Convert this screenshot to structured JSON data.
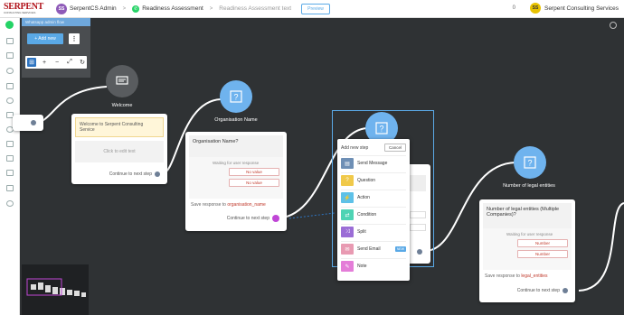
{
  "header": {
    "logo_text": "SERPENT",
    "logo_subtext": "CONSULTING SERVICES",
    "org_avatar": "SS",
    "org_name": "SerpentCS Admin",
    "flow_name": "Readiness Assessment",
    "flow_subtitle": "Readiness Assessment text",
    "preview_label": "Preview",
    "notifications": "0",
    "user_avatar": "SS",
    "user_name": "Serpent Consulting Services"
  },
  "toolbar": {
    "title": "Whatsapp admin flow",
    "add_label": "+ Add new",
    "kebab": "⋮"
  },
  "nodes": {
    "welcome": {
      "title": "Welcome",
      "message": "Welcome to Serpent Consulting Service",
      "edit_hint": "Click to edit text",
      "continue": "Continue to next step"
    },
    "org_name": {
      "title": "Organisation Name",
      "question": "Organisation Name?",
      "hint": "Waiting for user response",
      "options": [
        "No value",
        "No value"
      ],
      "save_prefix": "Save response to ",
      "save_var": "organisation_name",
      "continue": "Continue to next step"
    },
    "legal": {
      "title": "Number of legal entities",
      "question": "Number of legal entities (Multiple Companies)?",
      "hint": "Waiting for user response",
      "options": [
        "Number",
        "Number"
      ],
      "save_prefix": "Save response to ",
      "save_var": "legal_entities",
      "continue": "Continue to next step"
    }
  },
  "step_menu": {
    "title": "Add new step",
    "cancel": "Cancel",
    "new_badge": "NEW",
    "items": [
      {
        "label": "Send Message",
        "color": "#6e8fb5",
        "icon": "message-icon"
      },
      {
        "label": "Question",
        "color": "#f0c94a",
        "icon": "question-icon"
      },
      {
        "label": "Action",
        "color": "#5ec1e8",
        "icon": "action-icon"
      },
      {
        "label": "Condition",
        "color": "#4ed3b4",
        "icon": "condition-icon"
      },
      {
        "label": "Split",
        "color": "#9b6dd6",
        "icon": "split-icon"
      },
      {
        "label": "Send Email",
        "color": "#e89ab2",
        "icon": "email-icon"
      },
      {
        "label": "Note",
        "color": "#e47dd8",
        "icon": "note-icon"
      }
    ]
  }
}
